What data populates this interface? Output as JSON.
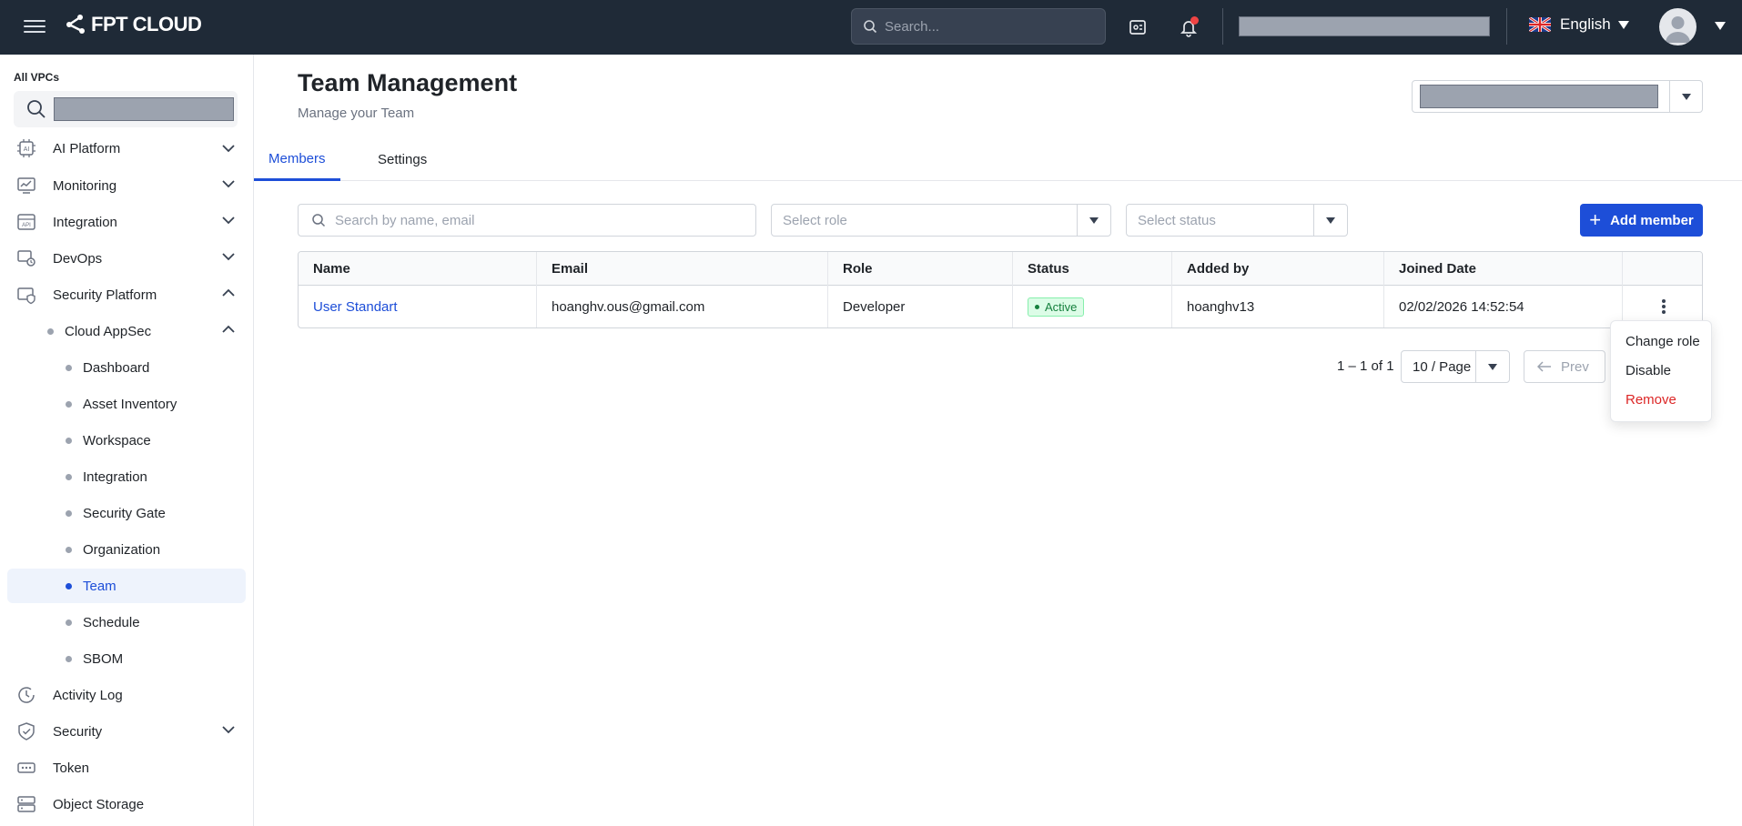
{
  "header": {
    "brand": "FPT CLOUD",
    "search_placeholder": "Search...",
    "language": "English"
  },
  "sidebar": {
    "vpc_label": "All VPCs",
    "items": [
      {
        "label": "AI Platform",
        "icon": "ai-chip-icon"
      },
      {
        "label": "Monitoring",
        "icon": "monitoring-icon"
      },
      {
        "label": "Integration",
        "icon": "api-icon"
      },
      {
        "label": "DevOps",
        "icon": "devops-icon"
      },
      {
        "label": "Security Platform",
        "icon": "security-platform-icon"
      }
    ],
    "group": "Cloud AppSec",
    "sub_items": [
      "Dashboard",
      "Asset Inventory",
      "Workspace",
      "Integration",
      "Security Gate",
      "Organization",
      "Team",
      "Schedule",
      "SBOM"
    ],
    "active_sub_item": "Team",
    "bottom_items": [
      {
        "label": "Activity Log",
        "icon": "clock-icon"
      },
      {
        "label": "Security",
        "icon": "shield-icon"
      },
      {
        "label": "Token",
        "icon": "token-icon"
      },
      {
        "label": "Object Storage",
        "icon": "storage-icon"
      }
    ]
  },
  "page": {
    "title": "Team Management",
    "subtitle": "Manage your Team"
  },
  "tabs": [
    "Members",
    "Settings"
  ],
  "filters": {
    "search_placeholder": "Search by name, email",
    "role_placeholder": "Select role",
    "status_placeholder": "Select status",
    "add_label": "Add member"
  },
  "table": {
    "columns": [
      "Name",
      "Email",
      "Role",
      "Status",
      "Added by",
      "Joined Date"
    ],
    "rows": [
      {
        "name": "User Standart",
        "email": "hoanghv.ous@gmail.com",
        "role": "Developer",
        "status": "Active",
        "added_by": "hoanghv13",
        "joined": "02/02/2026 14:52:54"
      }
    ]
  },
  "pagination": {
    "count": "1 – 1 of 1",
    "page_size": "10 / Page",
    "prev": "Prev"
  },
  "row_menu": [
    "Change role",
    "Disable",
    "Remove"
  ],
  "colors": {
    "topbar": "#1f2a37",
    "primary": "#1d4ed8",
    "danger": "#dc2626",
    "active_badge": "#15803d"
  }
}
